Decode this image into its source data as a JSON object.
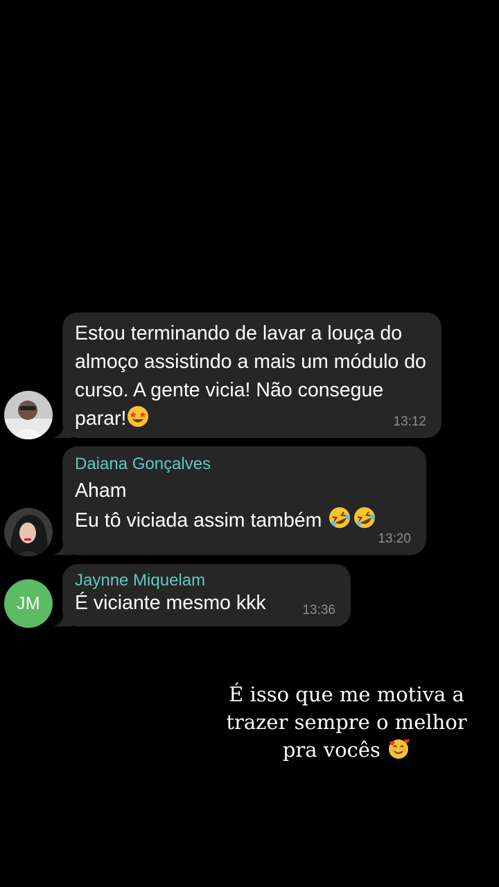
{
  "messages": [
    {
      "sender": "",
      "text": "Estou terminando de lavar a louça do almoço assistindo a mais um módulo do curso. A gente vicia! Não consegue parar!",
      "emoji": "star-struck-emoji",
      "time": "13:12"
    },
    {
      "sender": "Daiana Gonçalves",
      "line1": "Aham",
      "line2": "Eu tô viciada assim também",
      "emoji": "rolling-on-floor-laughing-emoji",
      "time": "13:20"
    },
    {
      "sender": "Jaynne Miquelam",
      "avatar_initials": "JM",
      "text": "É viciante mesmo kkk",
      "time": "13:36"
    }
  ],
  "caption": {
    "line1": "É isso que me motiva a",
    "line2": "trazer sempre o melhor",
    "line3": "pra vocês",
    "emoji": "smiling-face-with-hearts-emoji"
  },
  "colors": {
    "background": "#000000",
    "bubble": "#262626",
    "sender_name": "#5fc9c1",
    "timestamp": "#8e8e8e",
    "avatar_jm": "#5dbb63"
  }
}
